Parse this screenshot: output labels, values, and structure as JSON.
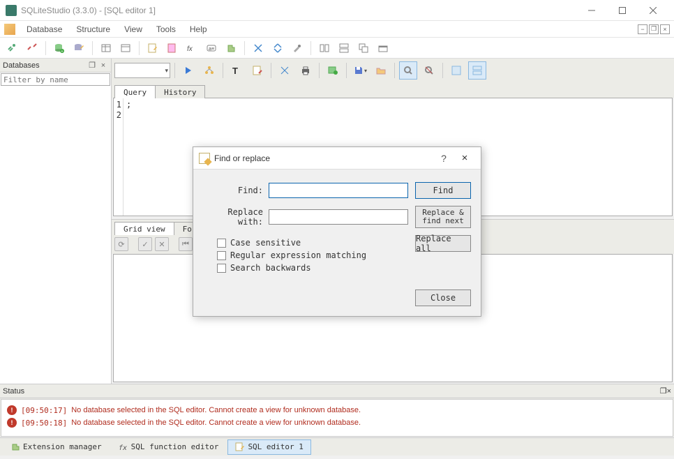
{
  "window": {
    "title": "SQLiteStudio (3.3.0) - [SQL editor 1]"
  },
  "menu": {
    "items": [
      "Database",
      "Structure",
      "View",
      "Tools",
      "Help"
    ]
  },
  "left_panel": {
    "title": "Databases",
    "filter_placeholder": "Filter by name"
  },
  "editor": {
    "tabs": [
      "Query",
      "History"
    ],
    "active_tab": 0,
    "lines": [
      "1",
      "2"
    ],
    "content": [
      ";",
      ""
    ]
  },
  "result_tabs": [
    "Grid view",
    "Form view"
  ],
  "status": {
    "title": "Status",
    "entries": [
      {
        "time": "[09:50:17]",
        "text": "No database selected in the SQL editor. Cannot create a view for unknown database."
      },
      {
        "time": "[09:50:18]",
        "text": "No database selected in the SQL editor. Cannot create a view for unknown database."
      }
    ]
  },
  "bottom_tabs": [
    {
      "label": "Extension manager",
      "active": false
    },
    {
      "label": "SQL function editor",
      "active": false
    },
    {
      "label": "SQL editor 1",
      "active": true
    }
  ],
  "dialog": {
    "title": "Find or replace",
    "find_label": "Find:",
    "replace_label": "Replace with:",
    "find_btn": "Find",
    "replace_next_btn": [
      "Replace &",
      "find next"
    ],
    "replace_all_btn": "Replace all",
    "close_btn": "Close",
    "checks": [
      "Case sensitive",
      "Regular expression matching",
      "Search backwards"
    ]
  },
  "colors": {
    "error": "#b02c1e",
    "accent": "#0a64ad"
  }
}
